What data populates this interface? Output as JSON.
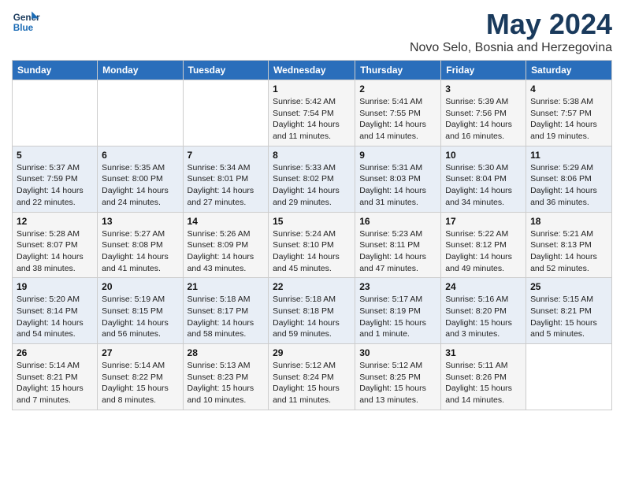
{
  "header": {
    "logo_line1": "General",
    "logo_line2": "Blue",
    "month_title": "May 2024",
    "location": "Novo Selo, Bosnia and Herzegovina"
  },
  "weekdays": [
    "Sunday",
    "Monday",
    "Tuesday",
    "Wednesday",
    "Thursday",
    "Friday",
    "Saturday"
  ],
  "weeks": [
    [
      {
        "day": "",
        "sunrise": "",
        "sunset": "",
        "daylight": ""
      },
      {
        "day": "",
        "sunrise": "",
        "sunset": "",
        "daylight": ""
      },
      {
        "day": "",
        "sunrise": "",
        "sunset": "",
        "daylight": ""
      },
      {
        "day": "1",
        "sunrise": "Sunrise: 5:42 AM",
        "sunset": "Sunset: 7:54 PM",
        "daylight": "Daylight: 14 hours and 11 minutes."
      },
      {
        "day": "2",
        "sunrise": "Sunrise: 5:41 AM",
        "sunset": "Sunset: 7:55 PM",
        "daylight": "Daylight: 14 hours and 14 minutes."
      },
      {
        "day": "3",
        "sunrise": "Sunrise: 5:39 AM",
        "sunset": "Sunset: 7:56 PM",
        "daylight": "Daylight: 14 hours and 16 minutes."
      },
      {
        "day": "4",
        "sunrise": "Sunrise: 5:38 AM",
        "sunset": "Sunset: 7:57 PM",
        "daylight": "Daylight: 14 hours and 19 minutes."
      }
    ],
    [
      {
        "day": "5",
        "sunrise": "Sunrise: 5:37 AM",
        "sunset": "Sunset: 7:59 PM",
        "daylight": "Daylight: 14 hours and 22 minutes."
      },
      {
        "day": "6",
        "sunrise": "Sunrise: 5:35 AM",
        "sunset": "Sunset: 8:00 PM",
        "daylight": "Daylight: 14 hours and 24 minutes."
      },
      {
        "day": "7",
        "sunrise": "Sunrise: 5:34 AM",
        "sunset": "Sunset: 8:01 PM",
        "daylight": "Daylight: 14 hours and 27 minutes."
      },
      {
        "day": "8",
        "sunrise": "Sunrise: 5:33 AM",
        "sunset": "Sunset: 8:02 PM",
        "daylight": "Daylight: 14 hours and 29 minutes."
      },
      {
        "day": "9",
        "sunrise": "Sunrise: 5:31 AM",
        "sunset": "Sunset: 8:03 PM",
        "daylight": "Daylight: 14 hours and 31 minutes."
      },
      {
        "day": "10",
        "sunrise": "Sunrise: 5:30 AM",
        "sunset": "Sunset: 8:04 PM",
        "daylight": "Daylight: 14 hours and 34 minutes."
      },
      {
        "day": "11",
        "sunrise": "Sunrise: 5:29 AM",
        "sunset": "Sunset: 8:06 PM",
        "daylight": "Daylight: 14 hours and 36 minutes."
      }
    ],
    [
      {
        "day": "12",
        "sunrise": "Sunrise: 5:28 AM",
        "sunset": "Sunset: 8:07 PM",
        "daylight": "Daylight: 14 hours and 38 minutes."
      },
      {
        "day": "13",
        "sunrise": "Sunrise: 5:27 AM",
        "sunset": "Sunset: 8:08 PM",
        "daylight": "Daylight: 14 hours and 41 minutes."
      },
      {
        "day": "14",
        "sunrise": "Sunrise: 5:26 AM",
        "sunset": "Sunset: 8:09 PM",
        "daylight": "Daylight: 14 hours and 43 minutes."
      },
      {
        "day": "15",
        "sunrise": "Sunrise: 5:24 AM",
        "sunset": "Sunset: 8:10 PM",
        "daylight": "Daylight: 14 hours and 45 minutes."
      },
      {
        "day": "16",
        "sunrise": "Sunrise: 5:23 AM",
        "sunset": "Sunset: 8:11 PM",
        "daylight": "Daylight: 14 hours and 47 minutes."
      },
      {
        "day": "17",
        "sunrise": "Sunrise: 5:22 AM",
        "sunset": "Sunset: 8:12 PM",
        "daylight": "Daylight: 14 hours and 49 minutes."
      },
      {
        "day": "18",
        "sunrise": "Sunrise: 5:21 AM",
        "sunset": "Sunset: 8:13 PM",
        "daylight": "Daylight: 14 hours and 52 minutes."
      }
    ],
    [
      {
        "day": "19",
        "sunrise": "Sunrise: 5:20 AM",
        "sunset": "Sunset: 8:14 PM",
        "daylight": "Daylight: 14 hours and 54 minutes."
      },
      {
        "day": "20",
        "sunrise": "Sunrise: 5:19 AM",
        "sunset": "Sunset: 8:15 PM",
        "daylight": "Daylight: 14 hours and 56 minutes."
      },
      {
        "day": "21",
        "sunrise": "Sunrise: 5:18 AM",
        "sunset": "Sunset: 8:17 PM",
        "daylight": "Daylight: 14 hours and 58 minutes."
      },
      {
        "day": "22",
        "sunrise": "Sunrise: 5:18 AM",
        "sunset": "Sunset: 8:18 PM",
        "daylight": "Daylight: 14 hours and 59 minutes."
      },
      {
        "day": "23",
        "sunrise": "Sunrise: 5:17 AM",
        "sunset": "Sunset: 8:19 PM",
        "daylight": "Daylight: 15 hours and 1 minute."
      },
      {
        "day": "24",
        "sunrise": "Sunrise: 5:16 AM",
        "sunset": "Sunset: 8:20 PM",
        "daylight": "Daylight: 15 hours and 3 minutes."
      },
      {
        "day": "25",
        "sunrise": "Sunrise: 5:15 AM",
        "sunset": "Sunset: 8:21 PM",
        "daylight": "Daylight: 15 hours and 5 minutes."
      }
    ],
    [
      {
        "day": "26",
        "sunrise": "Sunrise: 5:14 AM",
        "sunset": "Sunset: 8:21 PM",
        "daylight": "Daylight: 15 hours and 7 minutes."
      },
      {
        "day": "27",
        "sunrise": "Sunrise: 5:14 AM",
        "sunset": "Sunset: 8:22 PM",
        "daylight": "Daylight: 15 hours and 8 minutes."
      },
      {
        "day": "28",
        "sunrise": "Sunrise: 5:13 AM",
        "sunset": "Sunset: 8:23 PM",
        "daylight": "Daylight: 15 hours and 10 minutes."
      },
      {
        "day": "29",
        "sunrise": "Sunrise: 5:12 AM",
        "sunset": "Sunset: 8:24 PM",
        "daylight": "Daylight: 15 hours and 11 minutes."
      },
      {
        "day": "30",
        "sunrise": "Sunrise: 5:12 AM",
        "sunset": "Sunset: 8:25 PM",
        "daylight": "Daylight: 15 hours and 13 minutes."
      },
      {
        "day": "31",
        "sunrise": "Sunrise: 5:11 AM",
        "sunset": "Sunset: 8:26 PM",
        "daylight": "Daylight: 15 hours and 14 minutes."
      },
      {
        "day": "",
        "sunrise": "",
        "sunset": "",
        "daylight": ""
      }
    ]
  ]
}
